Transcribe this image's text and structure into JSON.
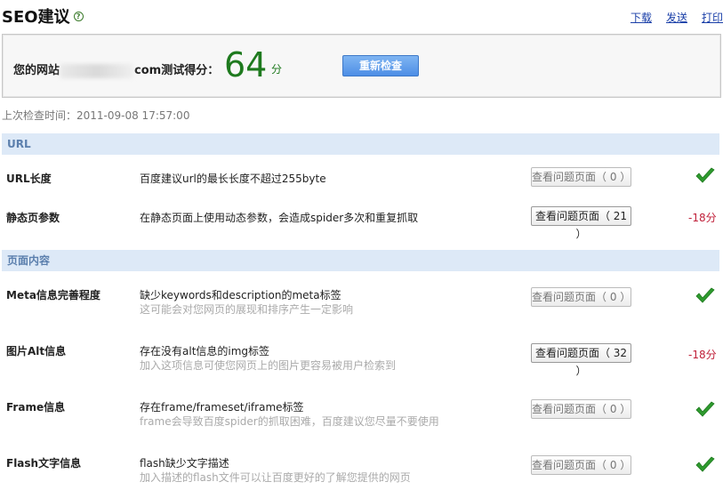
{
  "header": {
    "title": "SEO建议",
    "links": [
      "下载",
      "发送",
      "打印"
    ]
  },
  "score": {
    "label_prefix": "您的网站",
    "label_suffix": "com测试得分：",
    "value": "64",
    "unit": "分",
    "recheck_label": "重新检查"
  },
  "last_check": "上次检查时间：2011-09-08 17:57:00",
  "sections": [
    {
      "title": "URL",
      "rows": [
        {
          "name": "URL长度",
          "desc": "百度建议url的最长长度不超过255byte",
          "sub": "",
          "button": "查看问题页面（ 0 ）",
          "status": "pass",
          "deduct": ""
        },
        {
          "name": "静态页参数",
          "desc": "在静态页面上使用动态参数，会造成spider多次和重复抓取",
          "sub": "",
          "button": "查看问题页面（ 21 ）",
          "status": "fail",
          "deduct": "-18分"
        }
      ]
    },
    {
      "title": "页面内容",
      "rows": [
        {
          "name": "Meta信息完善程度",
          "desc": "缺少keywords和description的meta标签",
          "sub": "这可能会对您网页的展现和排序产生一定影响",
          "button": "查看问题页面（ 0 ）",
          "status": "pass",
          "deduct": ""
        },
        {
          "name": "图片Alt信息",
          "desc": "存在没有alt信息的img标签",
          "sub": "加入这项信息可使您网页上的图片更容易被用户检索到",
          "button": "查看问题页面（ 32 ）",
          "status": "fail",
          "deduct": "-18分"
        },
        {
          "name": "Frame信息",
          "desc": "存在frame/frameset/iframe标签",
          "sub": "frame会导致百度spider的抓取困难，百度建议您尽量不要使用",
          "button": "查看问题页面（ 0 ）",
          "status": "pass",
          "deduct": ""
        },
        {
          "name": "Flash文字信息",
          "desc": "flash缺少文字描述",
          "sub": "加入描述的flash文件可以让百度更好的了解您提供的网页",
          "button": "查看问题页面（ 0 ）",
          "status": "pass",
          "deduct": ""
        }
      ]
    }
  ],
  "colors": {
    "pass": "#2e9a2e",
    "fail": "#c0203a",
    "section_bg": "#dde9f7",
    "accent": "#4d8ee6"
  }
}
